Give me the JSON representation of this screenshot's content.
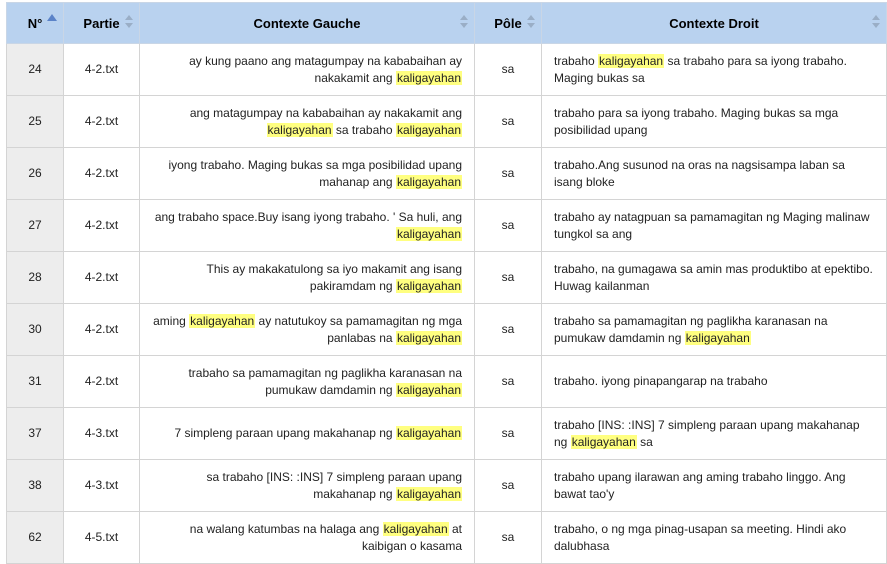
{
  "columns": {
    "num": "N°",
    "part": "Partie",
    "left": "Contexte Gauche",
    "pole": "Pôle",
    "right": "Contexte Droit"
  },
  "highlight_color": "#ffff80",
  "header_color": "#b9d2ef",
  "rows": [
    {
      "num": "24",
      "part": "4-2.txt",
      "pole": "sa",
      "left": [
        {
          "t": "ay kung paano ang matagumpay na kababaihan ay nakakamit ang "
        },
        {
          "t": "kaligayahan",
          "hl": true
        }
      ],
      "right": [
        {
          "t": "trabaho "
        },
        {
          "t": "kaligayahan",
          "hl": true
        },
        {
          "t": " sa trabaho para sa iyong trabaho. Maging bukas sa"
        }
      ]
    },
    {
      "num": "25",
      "part": "4-2.txt",
      "pole": "sa",
      "left": [
        {
          "t": "ang matagumpay na kababaihan ay nakakamit ang "
        },
        {
          "t": "kaligayahan",
          "hl": true
        },
        {
          "t": " sa trabaho "
        },
        {
          "t": "kaligayahan",
          "hl": true
        }
      ],
      "right": [
        {
          "t": "trabaho para sa iyong trabaho. Maging bukas sa mga posibilidad upang"
        }
      ]
    },
    {
      "num": "26",
      "part": "4-2.txt",
      "pole": "sa",
      "left": [
        {
          "t": "iyong trabaho. Maging bukas sa mga posibilidad upang mahanap ang "
        },
        {
          "t": "kaligayahan",
          "hl": true
        }
      ],
      "right": [
        {
          "t": "trabaho.Ang susunod na oras na nagsisampa laban sa isang bloke"
        }
      ]
    },
    {
      "num": "27",
      "part": "4-2.txt",
      "pole": "sa",
      "left": [
        {
          "t": "ang trabaho space.Buy isang iyong trabaho. ' Sa huli, ang "
        },
        {
          "t": "kaligayahan",
          "hl": true
        }
      ],
      "right": [
        {
          "t": "trabaho ay natagpuan sa pamamagitan ng Maging malinaw tungkol sa ang"
        }
      ]
    },
    {
      "num": "28",
      "part": "4-2.txt",
      "pole": "sa",
      "left": [
        {
          "t": "This ay makakatulong sa iyo makamit ang isang pakiramdam ng "
        },
        {
          "t": "kaligayahan",
          "hl": true
        }
      ],
      "right": [
        {
          "t": "trabaho, na gumagawa sa amin mas produktibo at epektibo. Huwag kailanman"
        }
      ]
    },
    {
      "num": "30",
      "part": "4-2.txt",
      "pole": "sa",
      "left": [
        {
          "t": "aming "
        },
        {
          "t": "kaligayahan",
          "hl": true
        },
        {
          "t": " ay natutukoy sa pamamagitan ng mga panlabas na "
        },
        {
          "t": "kaligayahan",
          "hl": true
        }
      ],
      "right": [
        {
          "t": "trabaho sa pamamagitan ng paglikha karanasan na pumukaw damdamin ng "
        },
        {
          "t": "kaligayahan",
          "hl": true
        }
      ]
    },
    {
      "num": "31",
      "part": "4-2.txt",
      "pole": "sa",
      "left": [
        {
          "t": "trabaho sa pamamagitan ng paglikha karanasan na pumukaw damdamin ng "
        },
        {
          "t": "kaligayahan",
          "hl": true
        }
      ],
      "right": [
        {
          "t": "trabaho. iyong pinapangarap na trabaho"
        }
      ]
    },
    {
      "num": "37",
      "part": "4-3.txt",
      "pole": "sa",
      "left": [
        {
          "t": "7 simpleng paraan upang makahanap ng "
        },
        {
          "t": "kaligayahan",
          "hl": true
        }
      ],
      "right": [
        {
          "t": "trabaho [INS: :INS] 7 simpleng paraan upang makahanap ng "
        },
        {
          "t": "kaligayahan",
          "hl": true
        },
        {
          "t": " sa"
        }
      ]
    },
    {
      "num": "38",
      "part": "4-3.txt",
      "pole": "sa",
      "left": [
        {
          "t": "sa trabaho [INS: :INS] 7 simpleng paraan upang makahanap ng "
        },
        {
          "t": "kaligayahan",
          "hl": true
        }
      ],
      "right": [
        {
          "t": "trabaho upang ilarawan ang aming trabaho linggo. Ang bawat tao'y"
        }
      ]
    },
    {
      "num": "62",
      "part": "4-5.txt",
      "pole": "sa",
      "left": [
        {
          "t": "na walang katumbas na halaga ang "
        },
        {
          "t": "kaligayahan",
          "hl": true
        },
        {
          "t": " at kaibigan o kasama"
        }
      ],
      "right": [
        {
          "t": "trabaho, o ng mga pinag-usapan sa meeting. Hindi ako dalubhasa"
        }
      ]
    }
  ]
}
